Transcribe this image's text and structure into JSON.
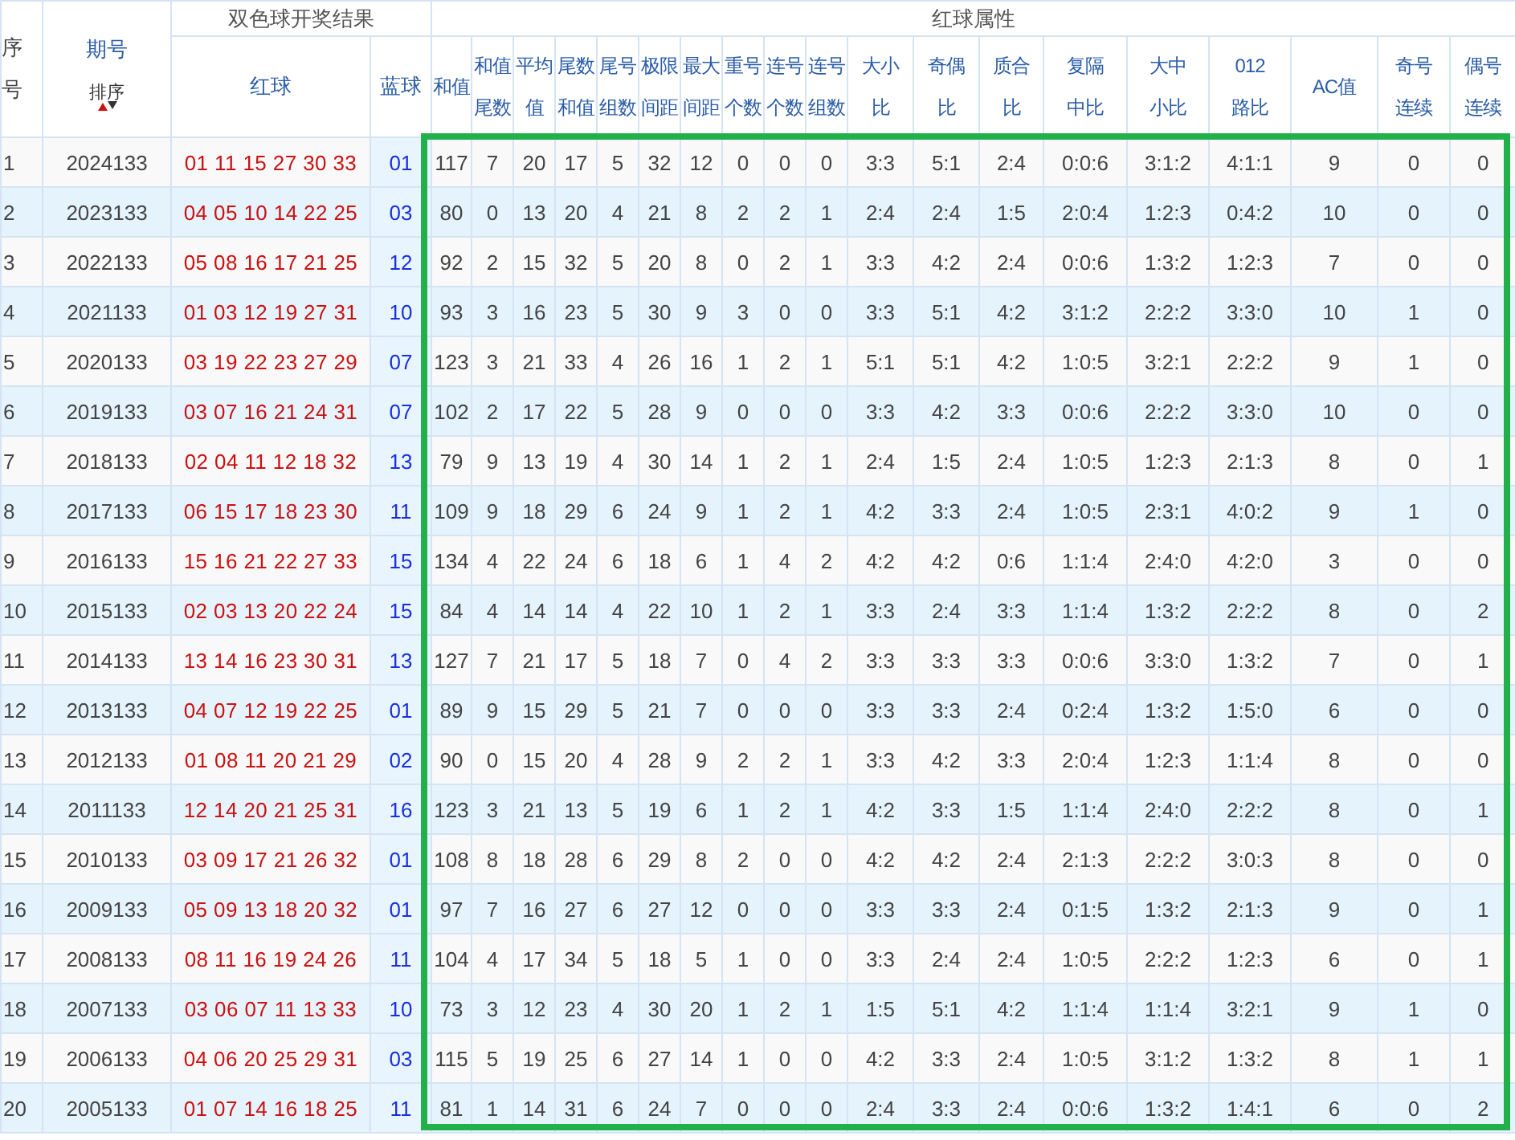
{
  "table": {
    "group_headers": [
      {
        "label": "双色球开奖结果",
        "kind": "results"
      },
      {
        "label": "红球属性",
        "kind": "attributes"
      }
    ],
    "index_header": [
      "序",
      "号"
    ],
    "issue_header": {
      "label": "期号",
      "sort_label": "排序"
    },
    "red_header": "红球",
    "blue_header": "蓝球",
    "attribute_headers": [
      [
        "和值"
      ],
      [
        "和值",
        "尾数"
      ],
      [
        "平均",
        "值"
      ],
      [
        "尾数",
        "和值"
      ],
      [
        "尾号",
        "组数"
      ],
      [
        "极限",
        "间距"
      ],
      [
        "最大",
        "间距"
      ],
      [
        "重号",
        "个数"
      ],
      [
        "连号",
        "个数"
      ],
      [
        "连号",
        "组数"
      ],
      [
        "大小",
        "比"
      ],
      [
        "奇偶",
        "比"
      ],
      [
        "质合",
        "比"
      ],
      [
        "复隔",
        "中比"
      ],
      [
        "大中",
        "小比"
      ],
      [
        "012",
        "路比"
      ],
      [
        "AC值"
      ],
      [
        "奇号",
        "连续"
      ],
      [
        "偶号",
        "连续"
      ]
    ],
    "rows": [
      {
        "index": "1",
        "issue": "2024133",
        "red": "01 11 15 27 30 33",
        "blue": "01",
        "attrs": [
          "117",
          "7",
          "20",
          "17",
          "5",
          "32",
          "12",
          "0",
          "0",
          "0",
          "3:3",
          "5:1",
          "2:4",
          "0:0:6",
          "3:1:2",
          "4:1:1",
          "9",
          "0",
          "0"
        ]
      },
      {
        "index": "2",
        "issue": "2023133",
        "red": "04 05 10 14 22 25",
        "blue": "03",
        "attrs": [
          "80",
          "0",
          "13",
          "20",
          "4",
          "21",
          "8",
          "2",
          "2",
          "1",
          "2:4",
          "2:4",
          "1:5",
          "2:0:4",
          "1:2:3",
          "0:4:2",
          "10",
          "0",
          "0"
        ]
      },
      {
        "index": "3",
        "issue": "2022133",
        "red": "05 08 16 17 21 25",
        "blue": "12",
        "attrs": [
          "92",
          "2",
          "15",
          "32",
          "5",
          "20",
          "8",
          "0",
          "2",
          "1",
          "3:3",
          "4:2",
          "2:4",
          "0:0:6",
          "1:3:2",
          "1:2:3",
          "7",
          "0",
          "0"
        ]
      },
      {
        "index": "4",
        "issue": "2021133",
        "red": "01 03 12 19 27 31",
        "blue": "10",
        "attrs": [
          "93",
          "3",
          "16",
          "23",
          "5",
          "30",
          "9",
          "3",
          "0",
          "0",
          "3:3",
          "5:1",
          "4:2",
          "3:1:2",
          "2:2:2",
          "3:3:0",
          "10",
          "1",
          "0"
        ]
      },
      {
        "index": "5",
        "issue": "2020133",
        "red": "03 19 22 23 27 29",
        "blue": "07",
        "attrs": [
          "123",
          "3",
          "21",
          "33",
          "4",
          "26",
          "16",
          "1",
          "2",
          "1",
          "5:1",
          "5:1",
          "4:2",
          "1:0:5",
          "3:2:1",
          "2:2:2",
          "9",
          "1",
          "0"
        ]
      },
      {
        "index": "6",
        "issue": "2019133",
        "red": "03 07 16 21 24 31",
        "blue": "07",
        "attrs": [
          "102",
          "2",
          "17",
          "22",
          "5",
          "28",
          "9",
          "0",
          "0",
          "0",
          "3:3",
          "4:2",
          "3:3",
          "0:0:6",
          "2:2:2",
          "3:3:0",
          "10",
          "0",
          "0"
        ]
      },
      {
        "index": "7",
        "issue": "2018133",
        "red": "02 04 11 12 18 32",
        "blue": "13",
        "attrs": [
          "79",
          "9",
          "13",
          "19",
          "4",
          "30",
          "14",
          "1",
          "2",
          "1",
          "2:4",
          "1:5",
          "2:4",
          "1:0:5",
          "1:2:3",
          "2:1:3",
          "8",
          "0",
          "1"
        ]
      },
      {
        "index": "8",
        "issue": "2017133",
        "red": "06 15 17 18 23 30",
        "blue": "11",
        "attrs": [
          "109",
          "9",
          "18",
          "29",
          "6",
          "24",
          "9",
          "1",
          "2",
          "1",
          "4:2",
          "3:3",
          "2:4",
          "1:0:5",
          "2:3:1",
          "4:0:2",
          "9",
          "1",
          "0"
        ]
      },
      {
        "index": "9",
        "issue": "2016133",
        "red": "15 16 21 22 27 33",
        "blue": "15",
        "attrs": [
          "134",
          "4",
          "22",
          "24",
          "6",
          "18",
          "6",
          "1",
          "4",
          "2",
          "4:2",
          "4:2",
          "0:6",
          "1:1:4",
          "2:4:0",
          "4:2:0",
          "3",
          "0",
          "0"
        ]
      },
      {
        "index": "10",
        "issue": "2015133",
        "red": "02 03 13 20 22 24",
        "blue": "15",
        "attrs": [
          "84",
          "4",
          "14",
          "14",
          "4",
          "22",
          "10",
          "1",
          "2",
          "1",
          "3:3",
          "2:4",
          "3:3",
          "1:1:4",
          "1:3:2",
          "2:2:2",
          "8",
          "0",
          "2"
        ]
      },
      {
        "index": "11",
        "issue": "2014133",
        "red": "13 14 16 23 30 31",
        "blue": "13",
        "attrs": [
          "127",
          "7",
          "21",
          "17",
          "5",
          "18",
          "7",
          "0",
          "4",
          "2",
          "3:3",
          "3:3",
          "3:3",
          "0:0:6",
          "3:3:0",
          "1:3:2",
          "7",
          "0",
          "1"
        ]
      },
      {
        "index": "12",
        "issue": "2013133",
        "red": "04 07 12 19 22 25",
        "blue": "01",
        "attrs": [
          "89",
          "9",
          "15",
          "29",
          "5",
          "21",
          "7",
          "0",
          "0",
          "0",
          "3:3",
          "3:3",
          "2:4",
          "0:2:4",
          "1:3:2",
          "1:5:0",
          "6",
          "0",
          "0"
        ]
      },
      {
        "index": "13",
        "issue": "2012133",
        "red": "01 08 11 20 21 29",
        "blue": "02",
        "attrs": [
          "90",
          "0",
          "15",
          "20",
          "4",
          "28",
          "9",
          "2",
          "2",
          "1",
          "3:3",
          "4:2",
          "3:3",
          "2:0:4",
          "1:2:3",
          "1:1:4",
          "8",
          "0",
          "0"
        ]
      },
      {
        "index": "14",
        "issue": "2011133",
        "red": "12 14 20 21 25 31",
        "blue": "16",
        "attrs": [
          "123",
          "3",
          "21",
          "13",
          "5",
          "19",
          "6",
          "1",
          "2",
          "1",
          "4:2",
          "3:3",
          "1:5",
          "1:1:4",
          "2:4:0",
          "2:2:2",
          "8",
          "0",
          "1"
        ]
      },
      {
        "index": "15",
        "issue": "2010133",
        "red": "03 09 17 21 26 32",
        "blue": "01",
        "attrs": [
          "108",
          "8",
          "18",
          "28",
          "6",
          "29",
          "8",
          "2",
          "0",
          "0",
          "4:2",
          "4:2",
          "2:4",
          "2:1:3",
          "2:2:2",
          "3:0:3",
          "8",
          "0",
          "0"
        ]
      },
      {
        "index": "16",
        "issue": "2009133",
        "red": "05 09 13 18 20 32",
        "blue": "01",
        "attrs": [
          "97",
          "7",
          "16",
          "27",
          "6",
          "27",
          "12",
          "0",
          "0",
          "0",
          "3:3",
          "3:3",
          "2:4",
          "0:1:5",
          "1:3:2",
          "2:1:3",
          "9",
          "0",
          "1"
        ]
      },
      {
        "index": "17",
        "issue": "2008133",
        "red": "08 11 16 19 24 26",
        "blue": "11",
        "attrs": [
          "104",
          "4",
          "17",
          "34",
          "5",
          "18",
          "5",
          "1",
          "0",
          "0",
          "3:3",
          "2:4",
          "2:4",
          "1:0:5",
          "2:2:2",
          "1:2:3",
          "6",
          "0",
          "1"
        ]
      },
      {
        "index": "18",
        "issue": "2007133",
        "red": "03 06 07 11 13 33",
        "blue": "10",
        "attrs": [
          "73",
          "3",
          "12",
          "23",
          "4",
          "30",
          "20",
          "1",
          "2",
          "1",
          "1:5",
          "5:1",
          "4:2",
          "1:1:4",
          "1:1:4",
          "3:2:1",
          "9",
          "1",
          "0"
        ]
      },
      {
        "index": "19",
        "issue": "2006133",
        "red": "04 06 20 25 29 31",
        "blue": "03",
        "attrs": [
          "115",
          "5",
          "19",
          "25",
          "6",
          "27",
          "14",
          "1",
          "0",
          "0",
          "4:2",
          "3:3",
          "2:4",
          "1:0:5",
          "3:1:2",
          "1:3:2",
          "8",
          "1",
          "1"
        ]
      },
      {
        "index": "20",
        "issue": "2005133",
        "red": "01 07 14 16 18 25",
        "blue": "11",
        "attrs": [
          "81",
          "1",
          "14",
          "31",
          "6",
          "24",
          "7",
          "0",
          "0",
          "0",
          "2:4",
          "3:3",
          "2:4",
          "0:0:6",
          "1:3:2",
          "1:4:1",
          "6",
          "0",
          "2"
        ]
      }
    ]
  }
}
